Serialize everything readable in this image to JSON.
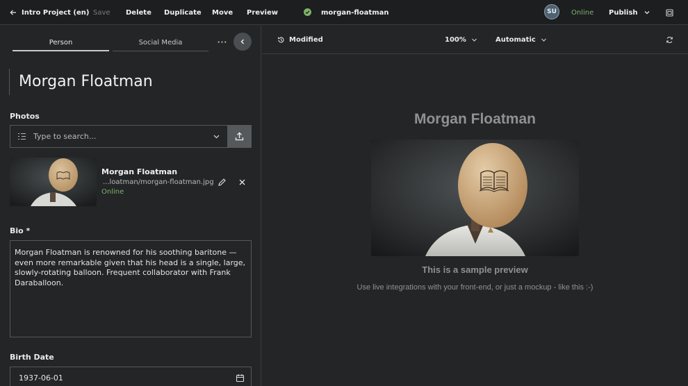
{
  "colors": {
    "accent_online": "#7fb36a",
    "tab_underline": "#c9cbcc"
  },
  "topbar": {
    "back_icon": "arrow-left-icon",
    "project": "Intro Project (en)",
    "save": "Save",
    "delete": "Delete",
    "duplicate": "Duplicate",
    "move": "Move",
    "preview": "Preview",
    "status_icon": "check-circle-icon",
    "doc_slug": "morgan-floatman",
    "avatar_initials": "SU",
    "online": "Online",
    "publish": "Publish",
    "publish_menu_icon": "chevron-down-icon",
    "panel_icon": "sidebar-icon"
  },
  "left": {
    "tabs": [
      {
        "label": "Person"
      },
      {
        "label": "Social Media"
      }
    ],
    "more_icon": "more-horizontal-icon",
    "collapse_icon": "chevron-left-icon",
    "title": "Morgan Floatman",
    "photos_label": "Photos",
    "search": {
      "placeholder": "Type to search...",
      "list_icon": "list-icon",
      "dropdown_icon": "chevron-down-icon",
      "upload_icon": "upload-icon"
    },
    "photo": {
      "name": "Morgan Floatman",
      "path": "...loatman/morgan-floatman.jpg",
      "status": "Online",
      "edit_icon": "pencil-icon",
      "remove_icon": "close-icon"
    },
    "bio_label": "Bio *",
    "bio_text": "Morgan Floatman is renowned for his soothing baritone — even more remarkable given that his head is a single, large, slowly-rotating balloon. Frequent collaborator with Frank Daraballoon.",
    "birth_label": "Birth Date",
    "birth_value": "1937-06-01",
    "calendar_icon": "calendar-icon"
  },
  "right": {
    "history_icon": "history-icon",
    "modified": "Modified",
    "zoom": "100%",
    "mode": "Automatic",
    "refresh_icon": "refresh-icon",
    "preview_title": "Morgan Floatman",
    "preview_sub": "This is a sample preview",
    "preview_note": "Use live integrations with your front-end, or just a mockup - like this :-)"
  }
}
